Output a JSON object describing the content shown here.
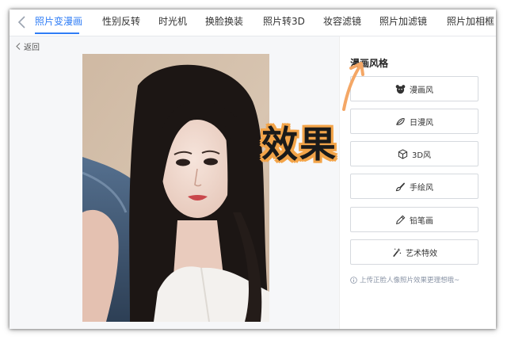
{
  "tabs": [
    {
      "label": "照片变漫画",
      "active": true
    },
    {
      "label": "性别反转",
      "active": false
    },
    {
      "label": "时光机",
      "active": false
    },
    {
      "label": "换脸换装",
      "active": false
    },
    {
      "label": "照片转3D",
      "active": false
    },
    {
      "label": "妆容滤镜",
      "active": false
    },
    {
      "label": "照片加滤镜",
      "active": false
    },
    {
      "label": "照片加相框",
      "active": false
    }
  ],
  "back": {
    "label": "返回"
  },
  "panel": {
    "title": "漫画风格",
    "buttons": [
      {
        "label": "漫画风",
        "icon": "bear-face-icon"
      },
      {
        "label": "日漫风",
        "icon": "leaf-swirl-icon"
      },
      {
        "label": "3D风",
        "icon": "cube-icon"
      },
      {
        "label": "手绘风",
        "icon": "brush-icon"
      },
      {
        "label": "铅笔画",
        "icon": "pencil-icon"
      },
      {
        "label": "艺术特效",
        "icon": "magic-wand-icon"
      }
    ],
    "hint": "上传正脸人像照片效果更理想哦~"
  },
  "overlay": {
    "effect_text": "效果"
  },
  "colors": {
    "accent": "#2f7df6",
    "overlay_outline": "#f3a449",
    "arrow": "#f4a766",
    "left_bg": "#f6f7f9"
  }
}
